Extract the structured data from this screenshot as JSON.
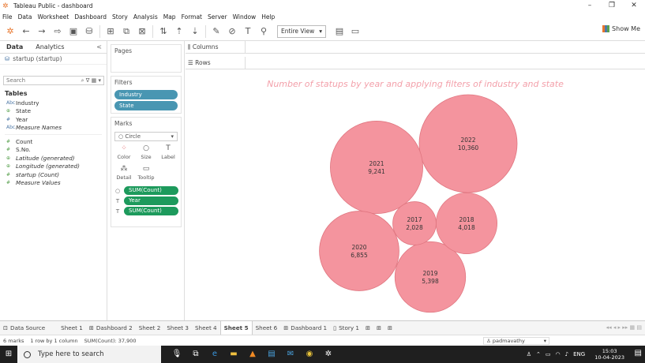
{
  "window": {
    "title": "Tableau Public - dashboard",
    "controls": [
      "–",
      "❐",
      "✕"
    ]
  },
  "menu": [
    "File",
    "Data",
    "Worksheet",
    "Dashboard",
    "Story",
    "Analysis",
    "Map",
    "Format",
    "Server",
    "Window",
    "Help"
  ],
  "toolbar": {
    "view_select": "Entire View",
    "show_me": "Show Me"
  },
  "data_pane": {
    "tabs": [
      "Data",
      "Analytics"
    ],
    "collapse": "<",
    "datasource": "startup (startup)",
    "search_placeholder": "Search",
    "tables_heading": "Tables",
    "fields": [
      {
        "type": "Abc",
        "name": "Industry",
        "italic": false,
        "kind": "dim"
      },
      {
        "type": "⊕",
        "name": "State",
        "italic": false,
        "kind": "geo"
      },
      {
        "type": "#",
        "name": "Year",
        "italic": false,
        "kind": "dim"
      },
      {
        "type": "Abc",
        "name": "Measure Names",
        "italic": true,
        "kind": "dim"
      }
    ],
    "measures": [
      {
        "type": "#",
        "name": "Count",
        "italic": false,
        "kind": "meas"
      },
      {
        "type": "#",
        "name": "S.No.",
        "italic": false,
        "kind": "meas"
      },
      {
        "type": "⊕",
        "name": "Latitude (generated)",
        "italic": true,
        "kind": "geo"
      },
      {
        "type": "⊕",
        "name": "Longitude (generated)",
        "italic": true,
        "kind": "geo"
      },
      {
        "type": "#",
        "name": "startup (Count)",
        "italic": true,
        "kind": "meas"
      },
      {
        "type": "#",
        "name": "Measure Values",
        "italic": true,
        "kind": "meas"
      }
    ]
  },
  "shelves": {
    "pages": "Pages",
    "filters_title": "Filters",
    "filters": [
      "Industry",
      "State"
    ],
    "marks_title": "Marks",
    "mark_type": "Circle",
    "mark_buttons": [
      {
        "icon": "⁘",
        "label": "Color"
      },
      {
        "icon": "○",
        "label": "Size"
      },
      {
        "icon": "T",
        "label": "Label"
      },
      {
        "icon": "⁂",
        "label": "Detail"
      },
      {
        "icon": "▭",
        "label": "Tooltip"
      }
    ],
    "mark_fields": [
      {
        "icon": "○",
        "label": "SUM(Count)"
      },
      {
        "icon": "T",
        "label": "Year"
      },
      {
        "icon": "T",
        "label": "SUM(Count)"
      }
    ],
    "columns": "Columns",
    "rows": "Rows"
  },
  "chart_data": {
    "type": "packed-bubble",
    "title": "Number of statups by year and applying filters of industry and state",
    "color": "#f4949e",
    "points": [
      {
        "year": "2022",
        "value": 10360,
        "label": "10,360"
      },
      {
        "year": "2021",
        "value": 9241,
        "label": "9,241"
      },
      {
        "year": "2020",
        "value": 6855,
        "label": "6,855"
      },
      {
        "year": "2019",
        "value": 5398,
        "label": "5,398"
      },
      {
        "year": "2018",
        "value": 4018,
        "label": "4,018"
      },
      {
        "year": "2017",
        "value": 2028,
        "label": "2,028"
      }
    ]
  },
  "sheet_tabs": [
    {
      "icon": "⊡",
      "label": "Data Source",
      "active": false
    },
    {
      "icon": "",
      "label": "Sheet 1",
      "active": false
    },
    {
      "icon": "⊞",
      "label": "Dashboard 2",
      "active": false
    },
    {
      "icon": "",
      "label": "Sheet 2",
      "active": false
    },
    {
      "icon": "",
      "label": "Sheet 3",
      "active": false
    },
    {
      "icon": "",
      "label": "Sheet 4",
      "active": false
    },
    {
      "icon": "",
      "label": "Sheet 5",
      "active": true
    },
    {
      "icon": "",
      "label": "Sheet 6",
      "active": false
    },
    {
      "icon": "⊞",
      "label": "Dashboard 1",
      "active": false
    },
    {
      "icon": "▯",
      "label": "Story 1",
      "active": false
    }
  ],
  "status": {
    "marks": "6 marks",
    "rows_cols": "1 row by 1 column",
    "sum": "SUM(Count): 37,900",
    "user": "padmavathy"
  },
  "taskbar": {
    "search_placeholder": "Type here to search",
    "lang": "ENG",
    "time": "15:03",
    "date": "10-04-2023"
  }
}
